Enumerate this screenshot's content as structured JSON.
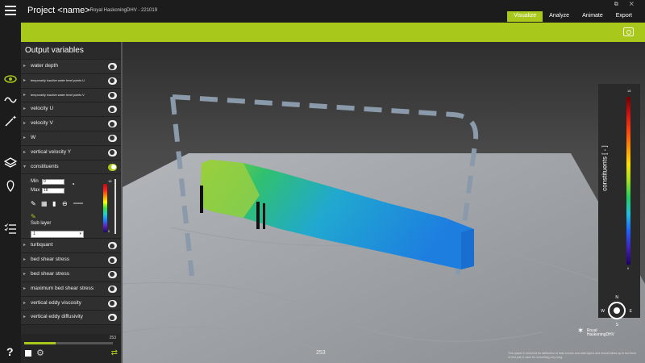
{
  "header": {
    "project_title": "Project <name>",
    "project_subtitle": "-  Royal HaskoningDHV  -  221019",
    "tabs": [
      {
        "label": "Visualize",
        "active": true
      },
      {
        "label": "Analyze",
        "active": false
      },
      {
        "label": "Animate",
        "active": false
      },
      {
        "label": "Export",
        "active": false
      }
    ]
  },
  "panel": {
    "title": "Output variables",
    "items_top": [
      {
        "label": "water depth",
        "tiny": false
      },
      {
        "label": "temporarily inactive water level points U",
        "tiny": true
      },
      {
        "label": "temporarily inactive water level points V",
        "tiny": true
      },
      {
        "label": "velocity U",
        "tiny": false
      },
      {
        "label": "velocity V",
        "tiny": false
      },
      {
        "label": "W",
        "tiny": false
      },
      {
        "label": "vertical velocity Y",
        "tiny": false
      },
      {
        "label": "constituents",
        "tiny": false
      }
    ],
    "constituents": {
      "min_label": "Min",
      "min_value": "0",
      "max_label": "Max",
      "max_value": "18",
      "sub_layer_label": "Sub layer",
      "sub_layer_value": "1",
      "scale_max": "18",
      "scale_min": "0"
    },
    "items_bottom": [
      {
        "label": "turbquant"
      },
      {
        "label": "bed shear stress"
      },
      {
        "label": "bed shear stress"
      },
      {
        "label": "maximum bed shear stress"
      },
      {
        "label": "vertical eddy viscosity"
      },
      {
        "label": "vertical eddy diffusivity"
      }
    ],
    "frame_number": "253",
    "progress": 0.35
  },
  "viewport": {
    "legend_title": "constituents  [  -  ]",
    "legend_max": "18",
    "legend_min": "0",
    "timestamp": "253",
    "compass": {
      "n": "N",
      "s": "S",
      "e": "E",
      "w": "W"
    },
    "logo_line1": "Royal",
    "logo_line2": "HaskoningDHV",
    "attribution": "This space is reserved for attribution of data source and data layers and should allow up to two lines of text just in case for something very long."
  },
  "colors": {
    "accent": "#a9c81c",
    "background": "#1c1c1c",
    "panel": "#2a2a2a"
  }
}
